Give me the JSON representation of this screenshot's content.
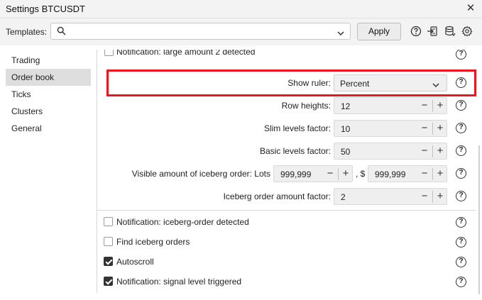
{
  "window": {
    "title": "Settings BTCUSDT",
    "close_glyph": "✕"
  },
  "templates": {
    "label": "Templates:",
    "value": "",
    "apply_label": "Apply"
  },
  "toolbar_icons": [
    "help-icon",
    "import-icon",
    "database-icon",
    "settings-icon"
  ],
  "sidebar": {
    "items": [
      {
        "label": "Trading",
        "active": false
      },
      {
        "label": "Order book",
        "active": true
      },
      {
        "label": "Ticks",
        "active": false
      },
      {
        "label": "Clusters",
        "active": false
      },
      {
        "label": "General",
        "active": false
      }
    ]
  },
  "settings": {
    "top_checkbox_label": "Notification: large amount 2 detected",
    "show_ruler": {
      "label": "Show ruler:",
      "value": "Percent"
    },
    "row_heights": {
      "label": "Row heights:",
      "value": "12"
    },
    "slim_levels": {
      "label": "Slim levels factor:",
      "value": "10"
    },
    "basic_levels": {
      "label": "Basic levels factor:",
      "value": "50"
    },
    "visible_iceberg": {
      "label": "Visible amount of iceberg order: Lots",
      "lots_value": "999,999",
      "sep_label": ", $",
      "usd_value": "999,999"
    },
    "iceberg_factor": {
      "label": "Iceberg order amount factor:",
      "value": "2"
    },
    "checkboxes": [
      {
        "label": "Notification: iceberg-order detected",
        "checked": false
      },
      {
        "label": "Find iceberg orders",
        "checked": false
      },
      {
        "label": "Autoscroll",
        "checked": true
      },
      {
        "label": "Notification: signal level triggered",
        "checked": true
      }
    ],
    "help_glyph": "?",
    "minus_glyph": "−",
    "plus_glyph": "+"
  },
  "colors": {
    "highlight": "#e8161d",
    "active_sidebar": "#dedede",
    "checked": "#333333"
  }
}
